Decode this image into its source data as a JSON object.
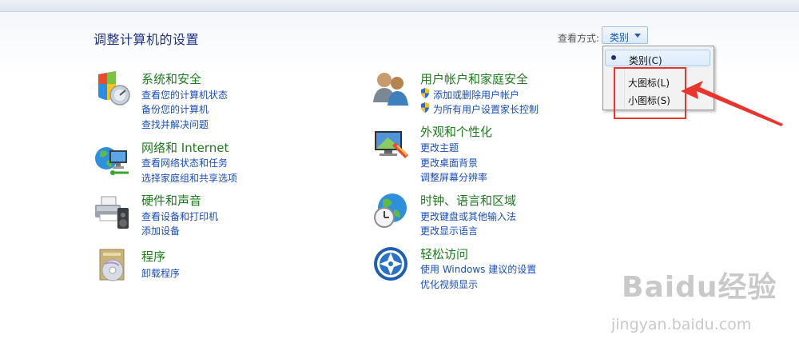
{
  "header": {
    "title": "调整计算机的设置",
    "view_by_label": "查看方式:",
    "view_by_value": "类别"
  },
  "view_menu": {
    "items": [
      {
        "label": "类别(C)",
        "selected": true
      },
      {
        "label": "大图标(L)",
        "selected": false
      },
      {
        "label": "小图标(S)",
        "selected": false
      }
    ]
  },
  "categories": [
    {
      "title": "系统和安全",
      "icon": "shield-computer-icon",
      "links": [
        "查看您的计算机状态",
        "备份您的计算机",
        "查找并解决问题"
      ]
    },
    {
      "title": "网络和 Internet",
      "icon": "network-globe-icon",
      "links": [
        "查看网络状态和任务",
        "选择家庭组和共享选项"
      ]
    },
    {
      "title": "硬件和声音",
      "icon": "printer-speaker-icon",
      "links": [
        "查看设备和打印机",
        "添加设备"
      ]
    },
    {
      "title": "程序",
      "icon": "programs-disc-icon",
      "links": [
        "卸载程序"
      ]
    },
    {
      "title": "用户帐户和家庭安全",
      "icon": "users-icon",
      "links": [
        "添加或删除用户帐户",
        "为所有用户设置家长控制"
      ]
    },
    {
      "title": "外观和个性化",
      "icon": "monitor-palette-icon",
      "links": [
        "更改主题",
        "更改桌面背景",
        "调整屏幕分辨率"
      ]
    },
    {
      "title": "时钟、语言和区域",
      "icon": "globe-clock-icon",
      "links": [
        "更改键盘或其他输入法",
        "更改显示语言"
      ]
    },
    {
      "title": "轻松访问",
      "icon": "ease-of-access-icon",
      "links": [
        "使用 Windows 建议的设置",
        "优化视频显示"
      ]
    }
  ],
  "watermark": {
    "brand": "Baidu经验",
    "url": "jingyan.baidu.com"
  },
  "colors": {
    "title": "#1e3287",
    "category_title": "#1e7a1e",
    "link": "#1a4dbd",
    "annotation_red": "#e9352d"
  }
}
